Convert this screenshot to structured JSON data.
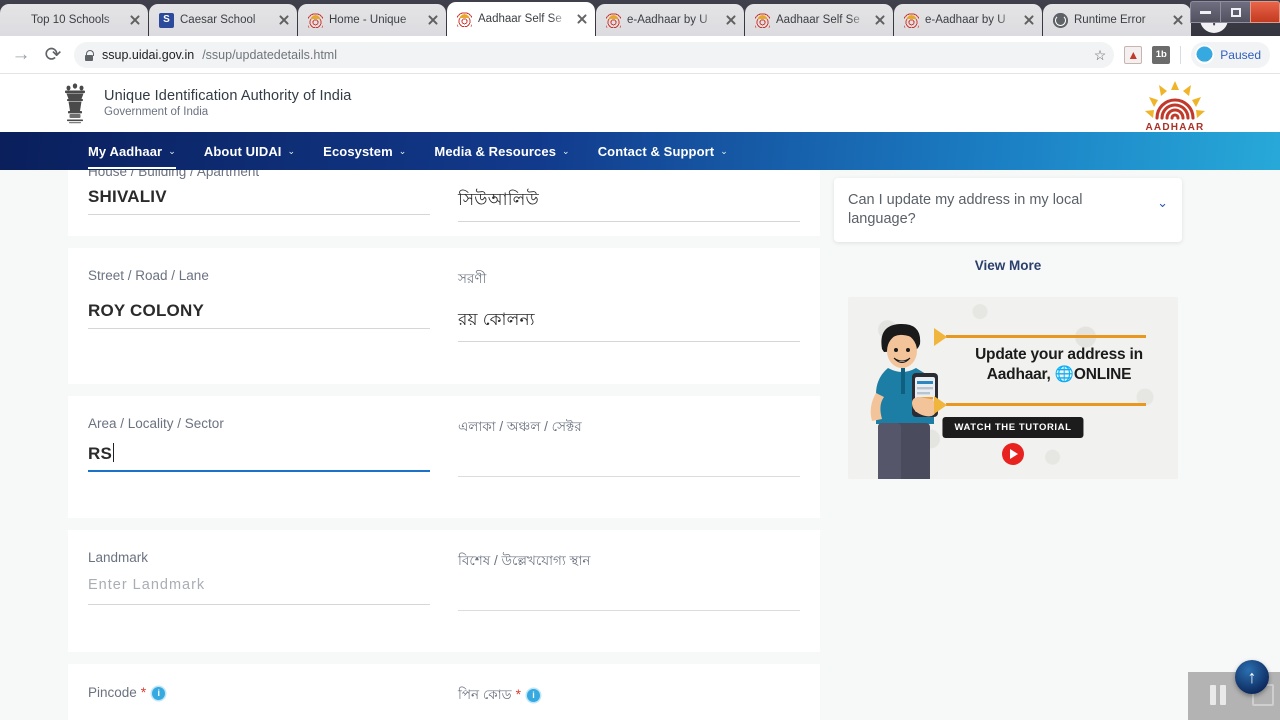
{
  "browser": {
    "tabs": [
      {
        "title": "Top 10 Schools",
        "icon": "blank-favicon",
        "active": false
      },
      {
        "title": "Caesar School",
        "icon": "s-favicon",
        "active": false
      },
      {
        "title": "Home - Unique",
        "icon": "aadhaar-favicon",
        "active": false
      },
      {
        "title": "Aadhaar Self Se",
        "icon": "aadhaar-favicon",
        "active": true
      },
      {
        "title": "e-Aadhaar by U",
        "icon": "aadhaar-favicon",
        "active": false
      },
      {
        "title": "Aadhaar Self Se",
        "icon": "aadhaar-favicon",
        "active": false
      },
      {
        "title": "e-Aadhaar by U",
        "icon": "aadhaar-favicon",
        "active": false
      },
      {
        "title": "Runtime Error",
        "icon": "globe-favicon",
        "active": false
      }
    ],
    "new_tab_label": "+",
    "url_host": "ssup.uidai.gov.in",
    "url_path": "/ssup/updatedetails.html",
    "profile_label": "Paused",
    "extensions": [
      {
        "name": "pdf-extension",
        "glyph": "☰"
      },
      {
        "name": "onetab-extension",
        "glyph": "1b"
      }
    ]
  },
  "site_header": {
    "title": "Unique Identification Authority of India",
    "subtitle": "Government of India",
    "logo_text": "AADHAAR"
  },
  "nav": {
    "items": [
      {
        "label": "My Aadhaar",
        "caret": "⌄",
        "active": true
      },
      {
        "label": "About UIDAI",
        "caret": "⌄",
        "active": false
      },
      {
        "label": "Ecosystem",
        "caret": "⌄",
        "active": false
      },
      {
        "label": "Media & Resources",
        "caret": "⌄",
        "active": false
      },
      {
        "label": "Contact & Support",
        "caret": "⌄",
        "active": false
      }
    ]
  },
  "form": {
    "fields": [
      {
        "name": "house-building-apartment",
        "label_en": "House / Building / Apartment",
        "label_bn": "",
        "value_en": "SHIVALIV",
        "value_bn": "সিউআলিউ",
        "placeholder_en": "",
        "focused": false,
        "clipped": true
      },
      {
        "name": "street-road-lane",
        "label_en": "Street / Road / Lane",
        "label_bn": "সরণী",
        "value_en": "ROY COLONY",
        "value_bn": "রয় কোলন্য",
        "placeholder_en": "",
        "focused": false,
        "resizable": true
      },
      {
        "name": "area-locality-sector",
        "label_en": "Area / Locality / Sector",
        "label_bn": "এলাকা / অঞ্চল / সেক্টর",
        "value_en": "RS",
        "value_bn": "",
        "placeholder_en": "",
        "focused": true
      },
      {
        "name": "landmark",
        "label_en": "Landmark",
        "label_bn": "বিশেষ / উল্লেখযোগ্য স্থান",
        "value_en": "",
        "value_bn": "",
        "placeholder_en": "Enter Landmark",
        "focused": false
      },
      {
        "name": "pincode",
        "label_en": "Pincode",
        "label_bn": "পিন কোড",
        "value_en": "",
        "value_bn": "",
        "placeholder_en": "",
        "required": true,
        "info": true,
        "focused": false
      }
    ],
    "required_mark": "*",
    "info_glyph": "i"
  },
  "sidebar": {
    "faq_question": "Can I update my address in my local language?",
    "faq_chevron": "⌄",
    "view_more": "View More",
    "banner": {
      "line1": "Update your address in",
      "line2_pre": "Aadhaar, ",
      "line2_globe": "🌐",
      "line2_post": "ONLINE",
      "button": "WATCH THE TUTORIAL"
    }
  },
  "overlays": {
    "scroll_top_arrow": "↑"
  }
}
